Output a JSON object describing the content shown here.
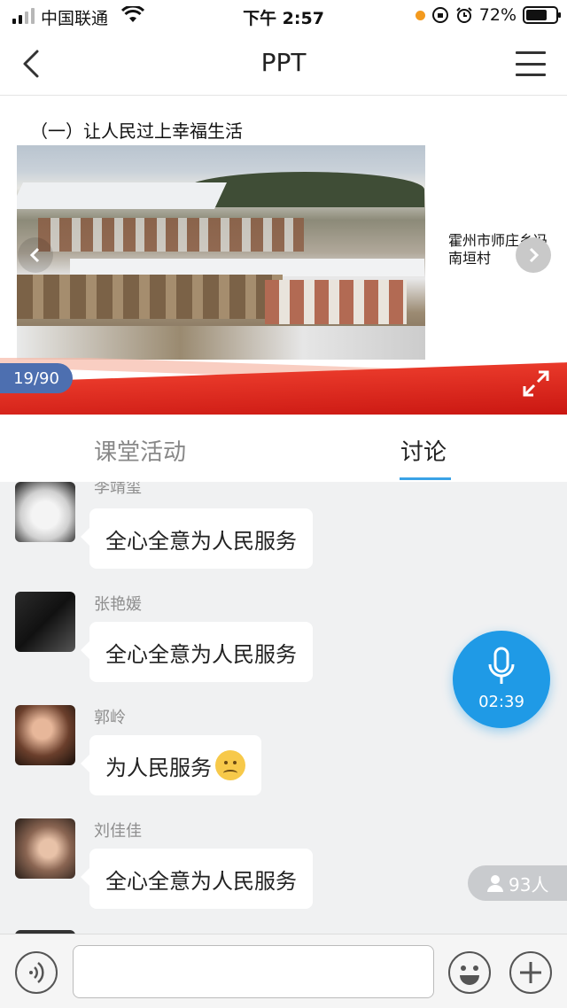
{
  "status_bar": {
    "carrier": "中国联通",
    "time": "下午 2:57",
    "battery": "72%",
    "battery_level": 0.72
  },
  "nav": {
    "title": "PPT"
  },
  "slide": {
    "heading": "（一）让人民过上幸福生活",
    "side_label": "霍州市师庄乡冯南垣村",
    "counter": "19/90"
  },
  "tabs": {
    "activity": "课堂活动",
    "discussion": "讨论"
  },
  "messages": [
    {
      "name": "李靖玺",
      "text": "全心全意为人民服务"
    },
    {
      "name": "张艳媛",
      "text": "全心全意为人民服务"
    },
    {
      "name": "郭岭",
      "text": "为人民服务"
    },
    {
      "name": "刘佳佳",
      "text": "全心全意为人民服务"
    }
  ],
  "voice_button": {
    "timer": "02:39"
  },
  "participants": {
    "count": "93人"
  },
  "input": {
    "placeholder": ""
  }
}
